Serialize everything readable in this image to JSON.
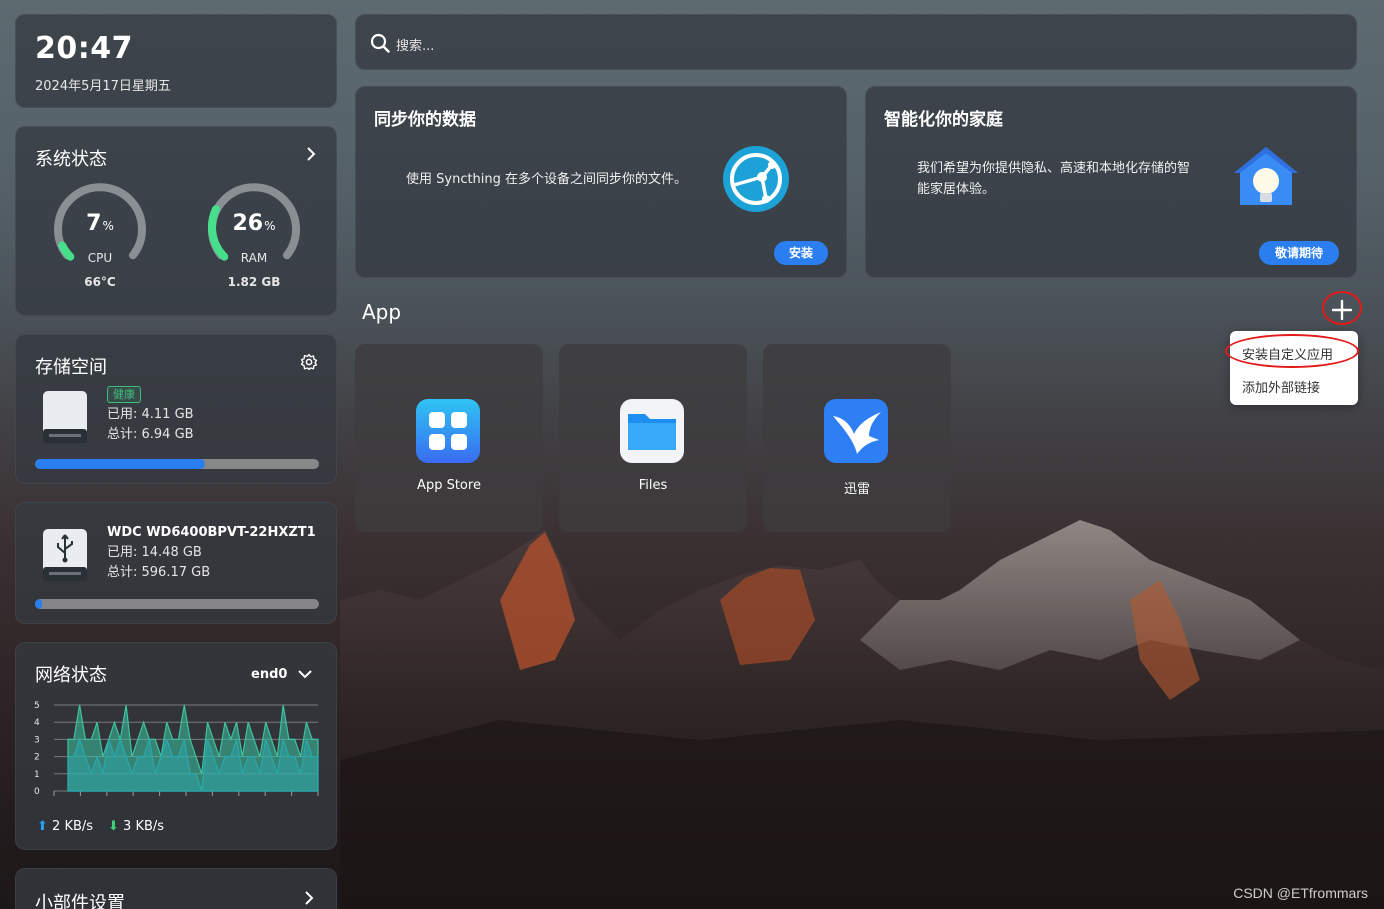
{
  "clock": {
    "time": "20:47",
    "date": "2024年5月17日星期五"
  },
  "system": {
    "title": "系统状态",
    "cpu": {
      "value": "7",
      "unit": "%",
      "label": "CPU",
      "sub": "66°C",
      "fraction": 0.07
    },
    "ram": {
      "value": "26",
      "unit": "%",
      "label": "RAM",
      "sub": "1.82 GB",
      "fraction": 0.26
    }
  },
  "storage": {
    "title": "存储空间",
    "disks": [
      {
        "badge": "健康",
        "used": "已用: 4.11 GB",
        "total": "总计: 6.94 GB",
        "fraction": 0.6
      },
      {
        "name": "WDC WD6400BPVT-22HXZT1",
        "used": "已用: 14.48 GB",
        "total": "总计: 596.17 GB",
        "fraction": 0.025
      }
    ]
  },
  "network": {
    "title": "网络状态",
    "interface": "end0",
    "upload": "2 KB/s",
    "download": "3 KB/s",
    "chart_data": {
      "type": "area",
      "title": "",
      "xlabel": "",
      "ylabel": "",
      "ylim": [
        0,
        5
      ],
      "yticks": [
        "0",
        "1",
        "2",
        "3",
        "4",
        "5"
      ],
      "series": [
        {
          "values": [
            3,
            3,
            5,
            3,
            3,
            4,
            2,
            3,
            4,
            3,
            5,
            2,
            3,
            4,
            3,
            3,
            2,
            4,
            3,
            3,
            5,
            3,
            2,
            1,
            4,
            3,
            2,
            4,
            3,
            4,
            2,
            4,
            3,
            2,
            4,
            3,
            2,
            5,
            3,
            3,
            2,
            4,
            3,
            3
          ]
        },
        {
          "values": [
            2,
            2,
            3,
            2,
            1,
            2,
            1,
            3,
            2,
            3,
            2,
            1,
            2,
            2,
            3,
            1,
            2,
            3,
            2,
            2,
            3,
            1,
            1,
            0,
            3,
            2,
            1,
            2,
            2,
            3,
            1,
            2,
            2,
            1,
            3,
            2,
            1,
            3,
            2,
            2,
            1,
            3,
            2,
            2
          ]
        }
      ],
      "colors": [
        "#3cc4a0",
        "#2aa8b0"
      ]
    }
  },
  "widget_settings": {
    "title": "小部件设置"
  },
  "search": {
    "placeholder": "搜索..."
  },
  "promos": [
    {
      "title": "同步你的数据",
      "desc": "使用 Syncthing 在多个设备之间同步你的文件。",
      "button": "安装"
    },
    {
      "title": "智能化你的家庭",
      "desc_line1": "我们希望为你提供隐私、高速和本地化存储的智",
      "desc_line2": "能家居体验。",
      "button": "敬请期待"
    }
  ],
  "apps_section": {
    "title": "App"
  },
  "menu": {
    "items": [
      "安装自定义应用",
      "添加外部链接"
    ]
  },
  "apps": [
    {
      "label": "App Store"
    },
    {
      "label": "Files"
    },
    {
      "label": "迅雷"
    }
  ],
  "watermark": "CSDN @ETfrommars",
  "colors": {
    "accent": "#2a7ef0",
    "gauge": "#46e08c",
    "healthy": "#3fbf7f",
    "annotation": "#e21a1a"
  }
}
